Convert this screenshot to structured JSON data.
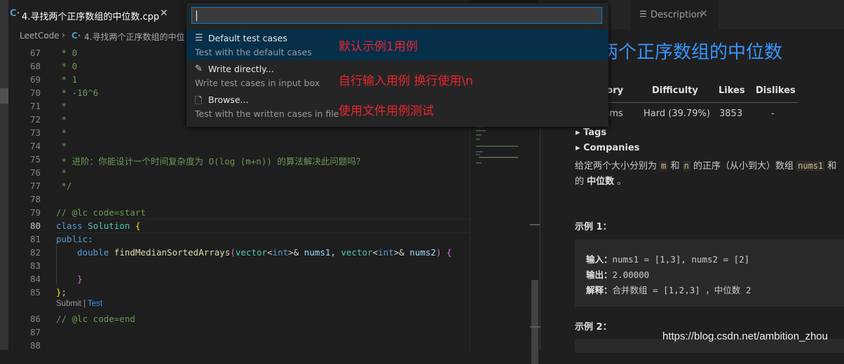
{
  "editor": {
    "tab_title": "4.寻找两个正序数组的中位数.cpp",
    "tab_icon": "cpp-icon",
    "breadcrumb": [
      "LeetCode",
      "4.寻找两个正序数组的中位"
    ],
    "line_numbers": [
      "67",
      "68",
      "69",
      "70",
      "71",
      "72",
      "73",
      "74",
      "75",
      "76",
      "77",
      "78",
      "79",
      "80",
      "81",
      "82",
      "83",
      "84",
      "85",
      "86",
      "87",
      "88"
    ],
    "active_line": "80",
    "code_lens": {
      "submit": "Submit",
      "sep": " | ",
      "test": "Test"
    }
  },
  "quick_pick": {
    "input_value": "",
    "items": [
      {
        "icon": "list-icon",
        "label": "Default test cases",
        "description": "Test with the default cases",
        "annotation": "默认示例1用例"
      },
      {
        "icon": "edit-icon",
        "label": "Write directly...",
        "description": "Write test cases in input box",
        "annotation": "自行输入用例 换行使用\\n"
      },
      {
        "icon": "file-icon",
        "label": "Browse...",
        "description": "Test with the written cases in file",
        "annotation": "使用文件用例测试"
      }
    ]
  },
  "description": {
    "tab_label": "Description",
    "title": "找两个正序数组的中位数",
    "table_headers": [
      "gory",
      "Difficulty",
      "Likes",
      "Dislikes"
    ],
    "table_values": [
      "thms",
      "Hard (39.79%)",
      "3853",
      "-"
    ],
    "tags_label": "Tags",
    "companies_label": "Companies",
    "para1_a": "给定两个大小分别为 ",
    "para1_m": "m",
    "para1_b": " 和 ",
    "para1_n": "n",
    "para1_c": " 的正序（从小到大）数组 ",
    "para1_nums1": "nums1",
    "para1_d": " 和",
    "para2_a": "的 ",
    "para2_b": "中位数",
    "para2_c": " 。",
    "example1_title": "示例 1：",
    "example1_input_label": "输入：",
    "example1_input": "nums1 = [1,3], nums2 = [2]",
    "example1_output_label": "输出：",
    "example1_output": "2.00000",
    "example1_explain_label": "解释：",
    "example1_explain": "合并数组 = [1,2,3] ，中位数 2",
    "example2_title": "示例 2：",
    "watermark": "https://blog.csdn.net/ambition_zhou"
  },
  "colors": {
    "accent": "#3794ff",
    "annotation": "#e8262b",
    "selection": "#062f4a"
  }
}
